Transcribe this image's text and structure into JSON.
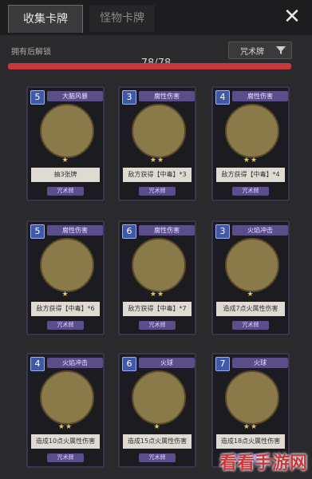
{
  "tabs": [
    {
      "label": "收集卡牌"
    },
    {
      "label": "怪物卡牌"
    }
  ],
  "header": {
    "unlocked_label": "拥有后解锁",
    "filter_label": "咒术牌",
    "count": "78/78",
    "progress_fraction": 1.0
  },
  "cards": [
    {
      "cost": "5",
      "name": "大脑风暴",
      "desc": "抽3张牌",
      "type": "咒术牌",
      "stars": 1
    },
    {
      "cost": "3",
      "name": "腐性伤害",
      "desc": "敌方获得【中毒】*3",
      "type": "咒术牌",
      "stars": 2
    },
    {
      "cost": "4",
      "name": "腐性伤害",
      "desc": "敌方获得【中毒】*4",
      "type": "咒术牌",
      "stars": 2
    },
    {
      "cost": "5",
      "name": "腐性伤害",
      "desc": "敌方获得【中毒】*6",
      "type": "咒术牌",
      "stars": 1
    },
    {
      "cost": "6",
      "name": "腐性伤害",
      "desc": "敌方获得【中毒】*7",
      "type": "咒术牌",
      "stars": 2
    },
    {
      "cost": "3",
      "name": "火焰冲击",
      "desc": "造成7点火属性伤害",
      "type": "咒术牌",
      "stars": 1
    },
    {
      "cost": "4",
      "name": "火焰冲击",
      "desc": "造成10点火属性伤害",
      "type": "咒术牌",
      "stars": 2
    },
    {
      "cost": "6",
      "name": "火球",
      "desc": "造成15点火属性伤害",
      "type": "咒术牌",
      "stars": 1
    },
    {
      "cost": "7",
      "name": "火球",
      "desc": "造成18点火属性伤害",
      "type": "咒术牌",
      "stars": 2
    }
  ],
  "watermark": "看看手游网",
  "icons": {
    "close": "close-icon",
    "filter": "funnel-icon"
  }
}
